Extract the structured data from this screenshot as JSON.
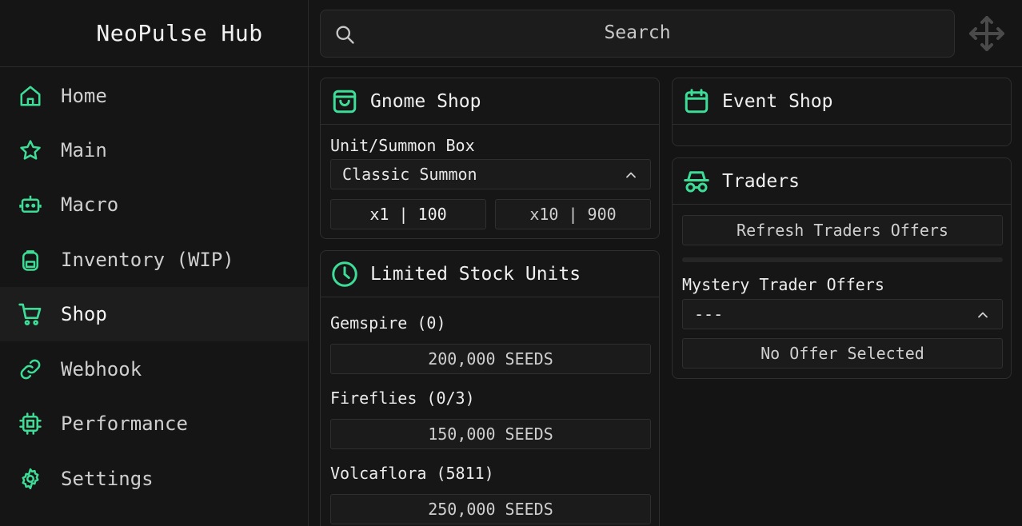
{
  "app": {
    "title": "NeoPulse Hub"
  },
  "search": {
    "placeholder": "Search"
  },
  "sidebar": {
    "items": [
      {
        "label": "Home",
        "icon": "home-icon"
      },
      {
        "label": "Main",
        "icon": "star-icon"
      },
      {
        "label": "Macro",
        "icon": "robot-icon"
      },
      {
        "label": "Inventory (WIP)",
        "icon": "backpack-icon"
      },
      {
        "label": "Shop",
        "icon": "cart-icon",
        "active": true
      },
      {
        "label": "Webhook",
        "icon": "link-icon"
      },
      {
        "label": "Performance",
        "icon": "cpu-icon"
      },
      {
        "label": "Settings",
        "icon": "gear-icon"
      }
    ]
  },
  "gnome_shop": {
    "title": "Gnome Shop",
    "field_label": "Unit/Summon Box",
    "selected": "Classic Summon",
    "buttons": [
      "x1 | 100",
      "x10 | 900"
    ]
  },
  "limited_stock": {
    "title": "Limited Stock Units",
    "items": [
      {
        "name": "Gemspire (0)",
        "price": "200,000 SEEDS"
      },
      {
        "name": "Fireflies (0/3)",
        "price": "150,000 SEEDS"
      },
      {
        "name": "Volcaflora (5811)",
        "price": "250,000 SEEDS"
      }
    ]
  },
  "event_shop": {
    "title": "Event Shop"
  },
  "traders": {
    "title": "Traders",
    "refresh_label": "Refresh Traders Offers",
    "mystery_label": "Mystery Trader Offers",
    "mystery_selected": "---",
    "status": "No Offer Selected"
  },
  "colors": {
    "accent": "#3ddc97",
    "background": "#141414",
    "panel": "#161616"
  }
}
